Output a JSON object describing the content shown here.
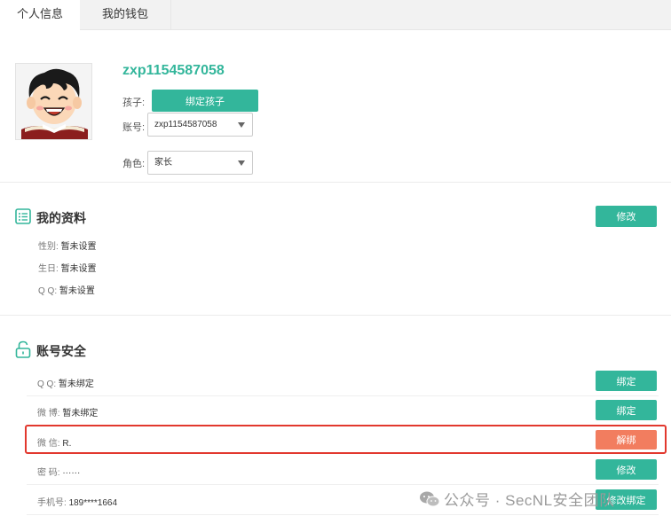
{
  "tabs": [
    {
      "label": "个人信息",
      "active": true
    },
    {
      "label": "我的钱包",
      "active": false
    }
  ],
  "profile": {
    "username": "zxp1154587058",
    "child_label": "孩子:",
    "bind_child_label": "绑定孩子",
    "account_label": "账号:",
    "account_value": "zxp1154587058",
    "role_label": "角色:",
    "role_value": "家长"
  },
  "my_info": {
    "title": "我的资料",
    "edit_label": "修改",
    "rows": [
      {
        "key": "性别:",
        "value": "暂未设置"
      },
      {
        "key": "生日:",
        "value": "暂未设置"
      },
      {
        "key": "Q Q:",
        "value": "暂未设置"
      }
    ]
  },
  "security": {
    "title": "账号安全",
    "rows": [
      {
        "key": "Q Q:",
        "value": "暂未绑定",
        "action": "绑定",
        "style": "green"
      },
      {
        "key": "微 博:",
        "value": "暂未绑定",
        "action": "绑定",
        "style": "green"
      },
      {
        "key": "微 信:",
        "value": "R.",
        "action": "解绑",
        "style": "orange"
      },
      {
        "key": "密 码:",
        "value": "······",
        "action": "修改",
        "style": "green"
      },
      {
        "key": "手机号:",
        "value": "189****1664",
        "action": "修改绑定",
        "style": "green"
      }
    ]
  },
  "watermark": "公众号 · SecNL安全团队",
  "colors": {
    "accent": "#33b69b",
    "danger": "#f27d5f",
    "highlight_border": "#e2382e"
  }
}
